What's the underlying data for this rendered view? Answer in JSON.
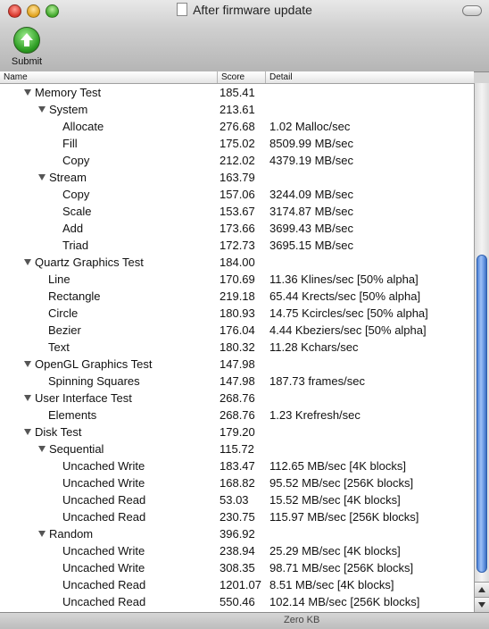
{
  "window": {
    "title": "After firmware update",
    "toolbar": {
      "submit_label": "Submit"
    }
  },
  "table": {
    "columns": {
      "name": "Name",
      "score": "Score",
      "detail": "Detail"
    },
    "rows": [
      {
        "level": 1,
        "expandable": true,
        "name": "Memory Test",
        "score": "185.41",
        "detail": ""
      },
      {
        "level": 2,
        "expandable": true,
        "name": "System",
        "score": "213.61",
        "detail": ""
      },
      {
        "level": 3,
        "expandable": false,
        "name": "Allocate",
        "score": "276.68",
        "detail": "1.02 Malloc/sec"
      },
      {
        "level": 3,
        "expandable": false,
        "name": "Fill",
        "score": "175.02",
        "detail": "8509.99 MB/sec"
      },
      {
        "level": 3,
        "expandable": false,
        "name": "Copy",
        "score": "212.02",
        "detail": "4379.19 MB/sec"
      },
      {
        "level": 2,
        "expandable": true,
        "name": "Stream",
        "score": "163.79",
        "detail": ""
      },
      {
        "level": 3,
        "expandable": false,
        "name": "Copy",
        "score": "157.06",
        "detail": "3244.09 MB/sec"
      },
      {
        "level": 3,
        "expandable": false,
        "name": "Scale",
        "score": "153.67",
        "detail": "3174.87 MB/sec"
      },
      {
        "level": 3,
        "expandable": false,
        "name": "Add",
        "score": "173.66",
        "detail": "3699.43 MB/sec"
      },
      {
        "level": 3,
        "expandable": false,
        "name": "Triad",
        "score": "172.73",
        "detail": "3695.15 MB/sec"
      },
      {
        "level": 1,
        "expandable": true,
        "name": "Quartz Graphics Test",
        "score": "184.00",
        "detail": ""
      },
      {
        "level": 2,
        "expandable": false,
        "name": "Line",
        "score": "170.69",
        "detail": "11.36 Klines/sec [50% alpha]"
      },
      {
        "level": 2,
        "expandable": false,
        "name": "Rectangle",
        "score": "219.18",
        "detail": "65.44 Krects/sec [50% alpha]"
      },
      {
        "level": 2,
        "expandable": false,
        "name": "Circle",
        "score": "180.93",
        "detail": "14.75 Kcircles/sec [50% alpha]"
      },
      {
        "level": 2,
        "expandable": false,
        "name": "Bezier",
        "score": "176.04",
        "detail": "4.44 Kbeziers/sec [50% alpha]"
      },
      {
        "level": 2,
        "expandable": false,
        "name": "Text",
        "score": "180.32",
        "detail": "11.28 Kchars/sec"
      },
      {
        "level": 1,
        "expandable": true,
        "name": "OpenGL Graphics Test",
        "score": "147.98",
        "detail": ""
      },
      {
        "level": 2,
        "expandable": false,
        "name": "Spinning Squares",
        "score": "147.98",
        "detail": "187.73 frames/sec"
      },
      {
        "level": 1,
        "expandable": true,
        "name": "User Interface Test",
        "score": "268.76",
        "detail": ""
      },
      {
        "level": 2,
        "expandable": false,
        "name": "Elements",
        "score": "268.76",
        "detail": "1.23 Krefresh/sec"
      },
      {
        "level": 1,
        "expandable": true,
        "name": "Disk Test",
        "score": "179.20",
        "detail": ""
      },
      {
        "level": 2,
        "expandable": true,
        "name": "Sequential",
        "score": "115.72",
        "detail": ""
      },
      {
        "level": 3,
        "expandable": false,
        "name": "Uncached Write",
        "score": "183.47",
        "detail": "112.65 MB/sec [4K blocks]"
      },
      {
        "level": 3,
        "expandable": false,
        "name": "Uncached Write",
        "score": "168.82",
        "detail": "95.52 MB/sec [256K blocks]"
      },
      {
        "level": 3,
        "expandable": false,
        "name": "Uncached Read",
        "score": "53.03",
        "detail": "15.52 MB/sec [4K blocks]"
      },
      {
        "level": 3,
        "expandable": false,
        "name": "Uncached Read",
        "score": "230.75",
        "detail": "115.97 MB/sec [256K blocks]"
      },
      {
        "level": 2,
        "expandable": true,
        "name": "Random",
        "score": "396.92",
        "detail": ""
      },
      {
        "level": 3,
        "expandable": false,
        "name": "Uncached Write",
        "score": "238.94",
        "detail": "25.29 MB/sec [4K blocks]"
      },
      {
        "level": 3,
        "expandable": false,
        "name": "Uncached Write",
        "score": "308.35",
        "detail": "98.71 MB/sec [256K blocks]"
      },
      {
        "level": 3,
        "expandable": false,
        "name": "Uncached Read",
        "score": "1201.07",
        "detail": "8.51 MB/sec [4K blocks]"
      },
      {
        "level": 3,
        "expandable": false,
        "name": "Uncached Read",
        "score": "550.46",
        "detail": "102.14 MB/sec [256K blocks]"
      }
    ]
  },
  "status_bar": {
    "text": "Zero KB"
  }
}
